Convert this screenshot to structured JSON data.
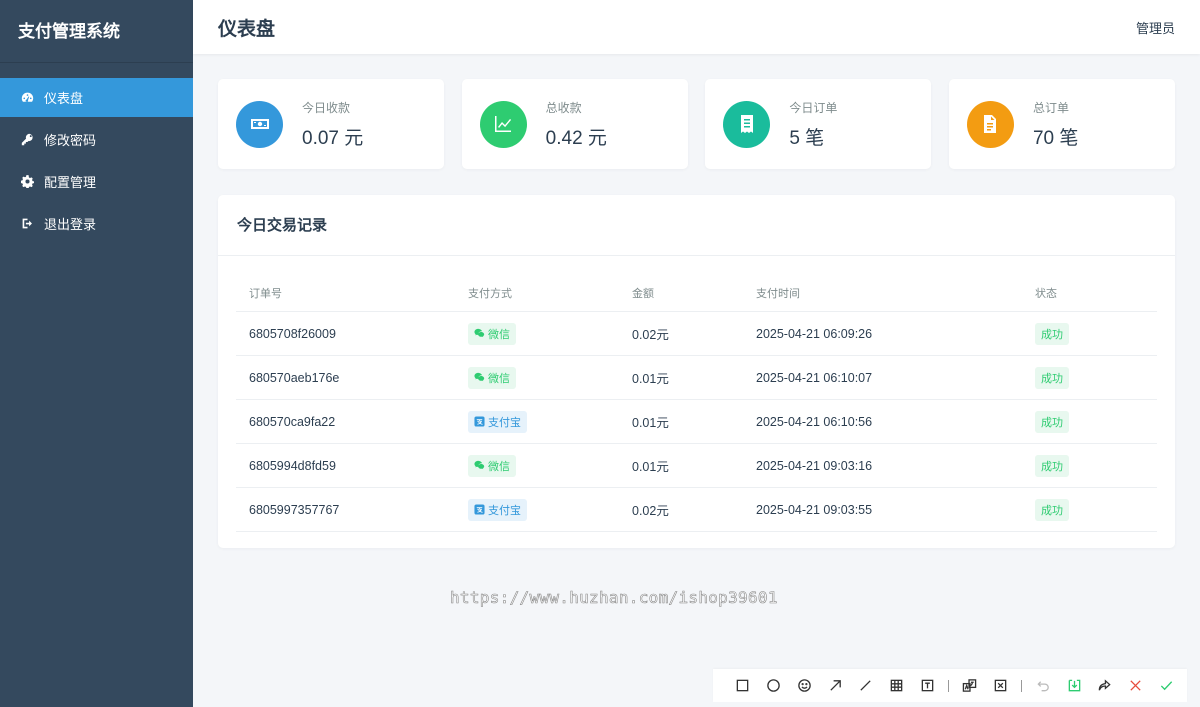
{
  "app": {
    "title": "支付管理系统"
  },
  "sidebar": {
    "items": [
      {
        "label": "仪表盘",
        "icon": "dashboard-icon",
        "active": true
      },
      {
        "label": "修改密码",
        "icon": "key-icon",
        "active": false
      },
      {
        "label": "配置管理",
        "icon": "gear-icon",
        "active": false
      },
      {
        "label": "退出登录",
        "icon": "logout-icon",
        "active": false
      }
    ]
  },
  "header": {
    "title": "仪表盘",
    "user": "管理员"
  },
  "stats": [
    {
      "label": "今日收款",
      "value": "0.07 元",
      "color": "#3498db",
      "icon": "money-icon"
    },
    {
      "label": "总收款",
      "value": "0.42 元",
      "color": "#2ecc71",
      "icon": "chart-line-icon"
    },
    {
      "label": "今日订单",
      "value": "5 笔",
      "color": "#1abc9c",
      "icon": "receipt-icon"
    },
    {
      "label": "总订单",
      "value": "70 笔",
      "color": "#f39c12",
      "icon": "file-icon"
    }
  ],
  "transactions": {
    "title": "今日交易记录",
    "columns": [
      "订单号",
      "支付方式",
      "金额",
      "支付时间",
      "状态"
    ],
    "rows": [
      {
        "order_no": "6805708f26009",
        "method": "微信",
        "method_type": "wechat",
        "amount": "0.02元",
        "time": "2025-04-21 06:09:26",
        "status": "成功"
      },
      {
        "order_no": "680570aeb176e",
        "method": "微信",
        "method_type": "wechat",
        "amount": "0.01元",
        "time": "2025-04-21 06:10:07",
        "status": "成功"
      },
      {
        "order_no": "680570ca9fa22",
        "method": "支付宝",
        "method_type": "alipay",
        "amount": "0.01元",
        "time": "2025-04-21 06:10:56",
        "status": "成功"
      },
      {
        "order_no": "6805994d8fd59",
        "method": "微信",
        "method_type": "wechat",
        "amount": "0.01元",
        "time": "2025-04-21 09:03:16",
        "status": "成功"
      },
      {
        "order_no": "6805997357767",
        "method": "支付宝",
        "method_type": "alipay",
        "amount": "0.02元",
        "time": "2025-04-21 09:03:55",
        "status": "成功"
      }
    ]
  },
  "watermark": "https://www.huzhan.com/ishop39601",
  "toolbar": {
    "tools": [
      "rectangle-icon",
      "circle-icon",
      "emoji-icon",
      "arrow-icon",
      "line-icon",
      "mosaic-icon",
      "text-icon",
      "|",
      "translate-icon",
      "ocr-icon",
      "|",
      "undo-icon",
      "download-icon",
      "share-icon",
      "close-icon",
      "confirm-icon"
    ]
  }
}
